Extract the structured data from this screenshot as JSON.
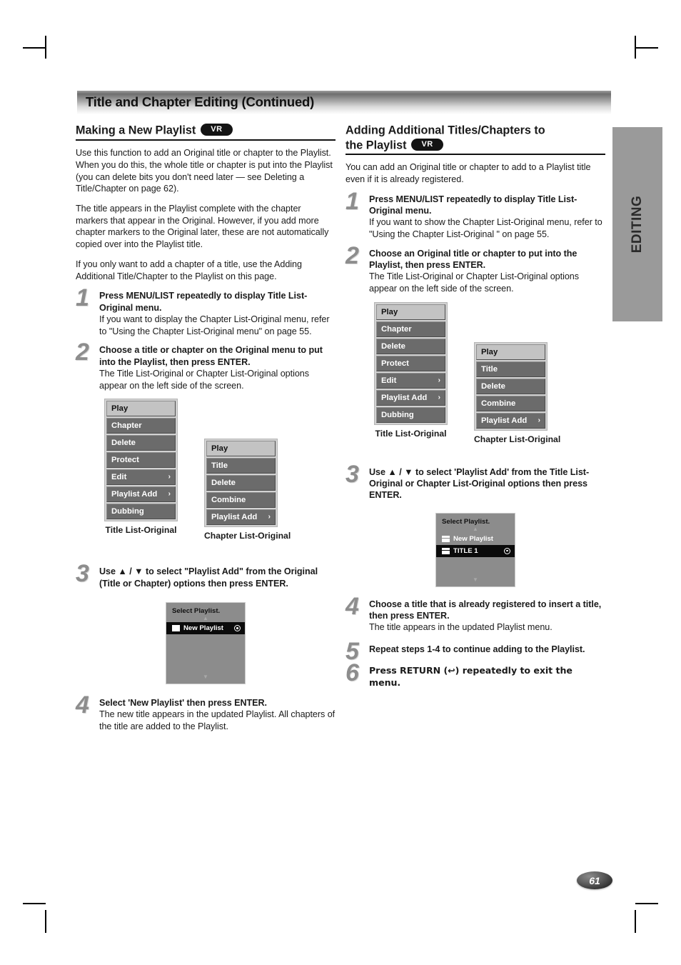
{
  "banner": {
    "title": "Title and Chapter Editing (Continued)"
  },
  "side_tab": {
    "label": "EDITING"
  },
  "page": {
    "number": "61"
  },
  "left_column": {
    "heading": "Making a New Playlist",
    "badge": "VR",
    "paragraphs": [
      "Use this function to add an Original title or chapter to the Playlist. When you do this, the whole title or chapter is put into the Playlist (you can delete bits you don't need later — see Deleting a Title/Chapter on page 62).",
      "The title appears in the Playlist complete with the chapter markers that appear in the Original. However, if you add more chapter markers to the Original later, these are not automatically copied over into the Playlist title.",
      "If you only want to add a chapter of a title, use the Adding Additional Title/Chapter to the Playlist on this page."
    ],
    "steps": [
      {
        "num": "1",
        "title": "Press MENU/LIST repeatedly to display Title List-Original menu.",
        "body": "If you want to display the Chapter List-Original menu, refer to \"Using the Chapter List-Original menu\" on page 55."
      },
      {
        "num": "2",
        "title": "Choose a title or chapter on the Original menu to put into the Playlist, then press ENTER.",
        "body": "The Title List-Original or Chapter List-Original options appear on the left side of the screen."
      },
      {
        "num": "3",
        "title": "Use ▲ / ▼ to select \"Playlist Add\" from the Original (Title or Chapter) options then press ENTER.",
        "body": ""
      },
      {
        "num": "4",
        "title": "Select 'New Playlist' then press ENTER.",
        "body": "The new title appears in the updated Playlist. All chapters of the title are added to the Playlist."
      }
    ],
    "title_menu": {
      "caption": "Title List-Original",
      "items": [
        {
          "label": "Play",
          "selected": true,
          "arrow": ""
        },
        {
          "label": "Chapter",
          "selected": false,
          "arrow": ""
        },
        {
          "label": "Delete",
          "selected": false,
          "arrow": ""
        },
        {
          "label": "Protect",
          "selected": false,
          "arrow": ""
        },
        {
          "label": "Edit",
          "selected": false,
          "arrow": "›"
        },
        {
          "label": "Playlist Add",
          "selected": false,
          "arrow": "›"
        },
        {
          "label": "Dubbing",
          "selected": false,
          "arrow": ""
        }
      ]
    },
    "chapter_menu": {
      "caption": "Chapter List-Original",
      "items": [
        {
          "label": "Play",
          "selected": true,
          "arrow": ""
        },
        {
          "label": "Title",
          "selected": false,
          "arrow": ""
        },
        {
          "label": "Delete",
          "selected": false,
          "arrow": ""
        },
        {
          "label": "Combine",
          "selected": false,
          "arrow": ""
        },
        {
          "label": "Playlist Add",
          "selected": false,
          "arrow": "›"
        }
      ]
    },
    "select_playlist": {
      "title": "Select Playlist.",
      "rows": [
        {
          "label": "New Playlist",
          "highlighted": true,
          "dot": true
        }
      ]
    }
  },
  "right_column": {
    "heading_line1": "Adding Additional Titles/Chapters to",
    "heading_line2": "the Playlist",
    "badge": "VR",
    "paragraphs": [
      "You can add an Original title or chapter to add to a Playlist title even if it is already registered."
    ],
    "steps": [
      {
        "num": "1",
        "title": "Press MENU/LIST repeatedly to display Title List-Original menu.",
        "body": "If you want to show the Chapter List-Original menu, refer to \"Using the Chapter List-Original \" on page 55."
      },
      {
        "num": "2",
        "title": "Choose an Original title or chapter to put into the Playlist, then press ENTER.",
        "body": "The Title List-Original or Chapter List-Original options appear on the left side of the screen."
      },
      {
        "num": "3",
        "title": "Use ▲ / ▼ to select 'Playlist Add' from the Title List-Original or Chapter List-Original options then press ENTER.",
        "body": ""
      },
      {
        "num": "4",
        "title": "Choose a title that is already registered to insert a title, then press ENTER.",
        "body": "The title appears in the updated Playlist menu."
      },
      {
        "num": "5",
        "title": "Repeat steps 1-4 to continue adding to the Playlist.",
        "body": ""
      },
      {
        "num": "6",
        "title": "Press RETURN (↩) repeatedly to exit the menu.",
        "body": ""
      }
    ],
    "title_menu": {
      "caption": "Title List-Original",
      "items": [
        {
          "label": "Play",
          "selected": true,
          "arrow": ""
        },
        {
          "label": "Chapter",
          "selected": false,
          "arrow": ""
        },
        {
          "label": "Delete",
          "selected": false,
          "arrow": ""
        },
        {
          "label": "Protect",
          "selected": false,
          "arrow": ""
        },
        {
          "label": "Edit",
          "selected": false,
          "arrow": "›"
        },
        {
          "label": "Playlist Add",
          "selected": false,
          "arrow": "›"
        },
        {
          "label": "Dubbing",
          "selected": false,
          "arrow": ""
        }
      ]
    },
    "chapter_menu": {
      "caption": "Chapter List-Original",
      "items": [
        {
          "label": "Play",
          "selected": true,
          "arrow": ""
        },
        {
          "label": "Title",
          "selected": false,
          "arrow": ""
        },
        {
          "label": "Delete",
          "selected": false,
          "arrow": ""
        },
        {
          "label": "Combine",
          "selected": false,
          "arrow": ""
        },
        {
          "label": "Playlist Add",
          "selected": false,
          "arrow": "›"
        }
      ]
    },
    "select_playlist": {
      "title": "Select Playlist.",
      "rows": [
        {
          "label": "New Playlist",
          "highlighted": false,
          "dot": false
        },
        {
          "label": "TITLE 1",
          "highlighted": true,
          "dot": true
        }
      ]
    }
  }
}
